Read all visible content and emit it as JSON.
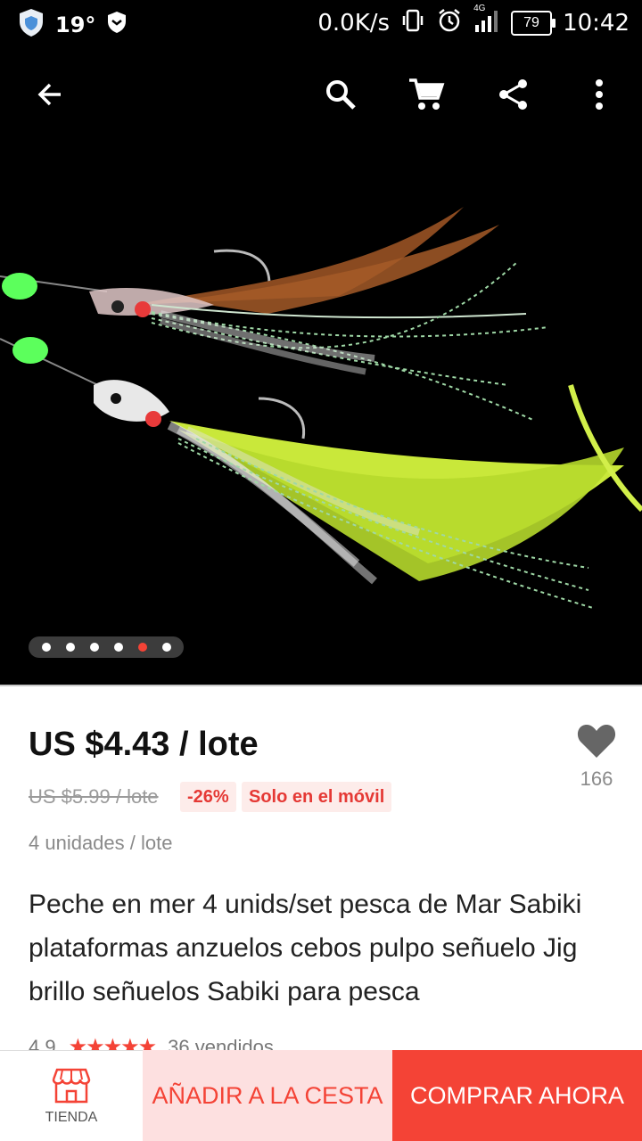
{
  "status_bar": {
    "temperature": "19°",
    "network_speed": "0.0K/s",
    "signal_label": "4G",
    "battery": "79",
    "time": "10:42"
  },
  "toolbar": {
    "back_icon": "arrow-left-icon",
    "search_icon": "search-icon",
    "cart_icon": "cart-icon",
    "share_icon": "share-icon",
    "more_icon": "more-vertical-icon"
  },
  "gallery": {
    "image_count": 6,
    "active_index": 4
  },
  "product": {
    "price": "US $4.43 / lote",
    "original_price": "US $5.99 / lote",
    "discount": "-26%",
    "mobile_only": "Solo en el móvil",
    "units": "4 unidades / lote",
    "title": "Peche en mer 4 unids/set pesca de Mar Sabiki plataformas anzuelos cebos pulpo señuelo Jig brillo señuelos Sabiki para pesca",
    "rating": "4.9",
    "stars": "★★★★★",
    "sold": "36 vendidos",
    "wishlist_count": "166"
  },
  "bottom_bar": {
    "store_label": "TIENDA",
    "add_to_cart": "AÑADIR A LA CESTA",
    "buy_now": "COMPRAR AHORA"
  },
  "colors": {
    "accent": "#f44336",
    "accent_light": "#fde0e0"
  }
}
